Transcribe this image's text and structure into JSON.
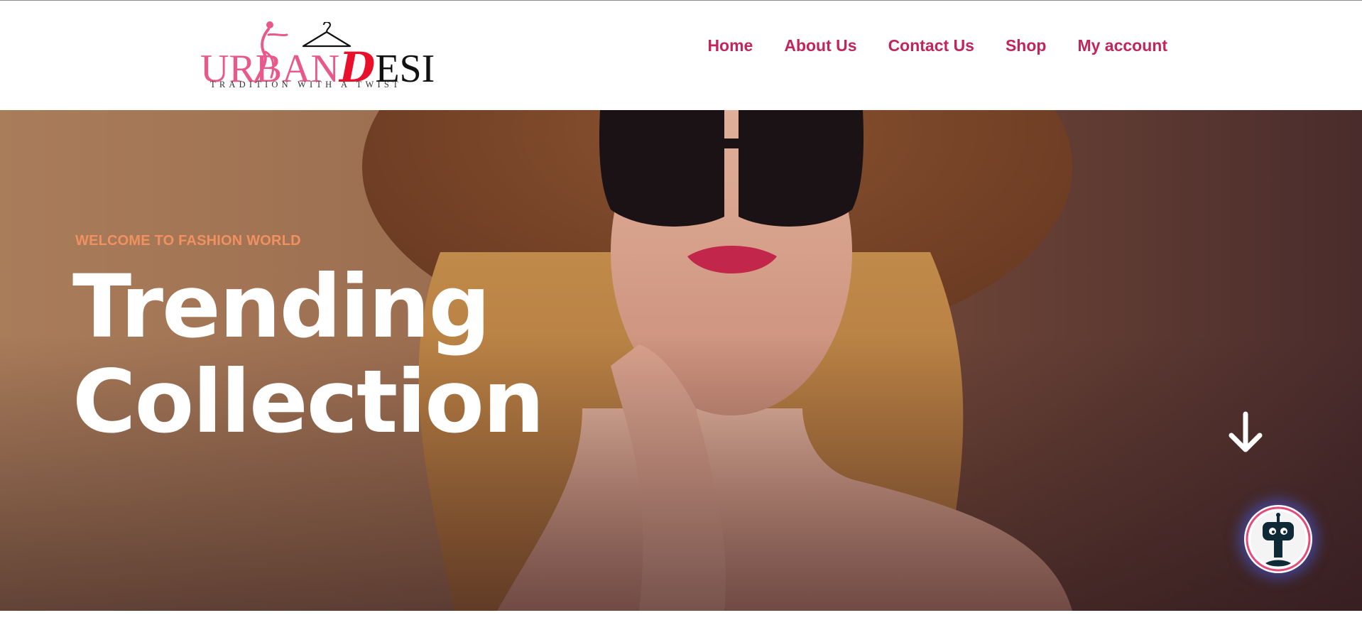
{
  "brand": {
    "name_part1": "URBAN",
    "name_part2": "D",
    "name_part3": "ESI",
    "tagline": "TRADITION WITH A TWIST"
  },
  "nav": {
    "items": [
      {
        "label": "Home"
      },
      {
        "label": "About Us"
      },
      {
        "label": "Contact Us"
      },
      {
        "label": "Shop"
      },
      {
        "label": "My account"
      }
    ]
  },
  "hero": {
    "eyebrow": "WELCOME TO FASHION WORLD",
    "title_line1": "Trending",
    "title_line2": "Collection"
  },
  "icons": {
    "scroll": "arrow-down-icon",
    "chat": "chatbot-icon"
  },
  "colors": {
    "nav_text": "#c2255c",
    "eyebrow": "#f1915f",
    "logo_pink": "#e8588a",
    "logo_red": "#e8102a",
    "chat_glow": "#4659dc"
  }
}
